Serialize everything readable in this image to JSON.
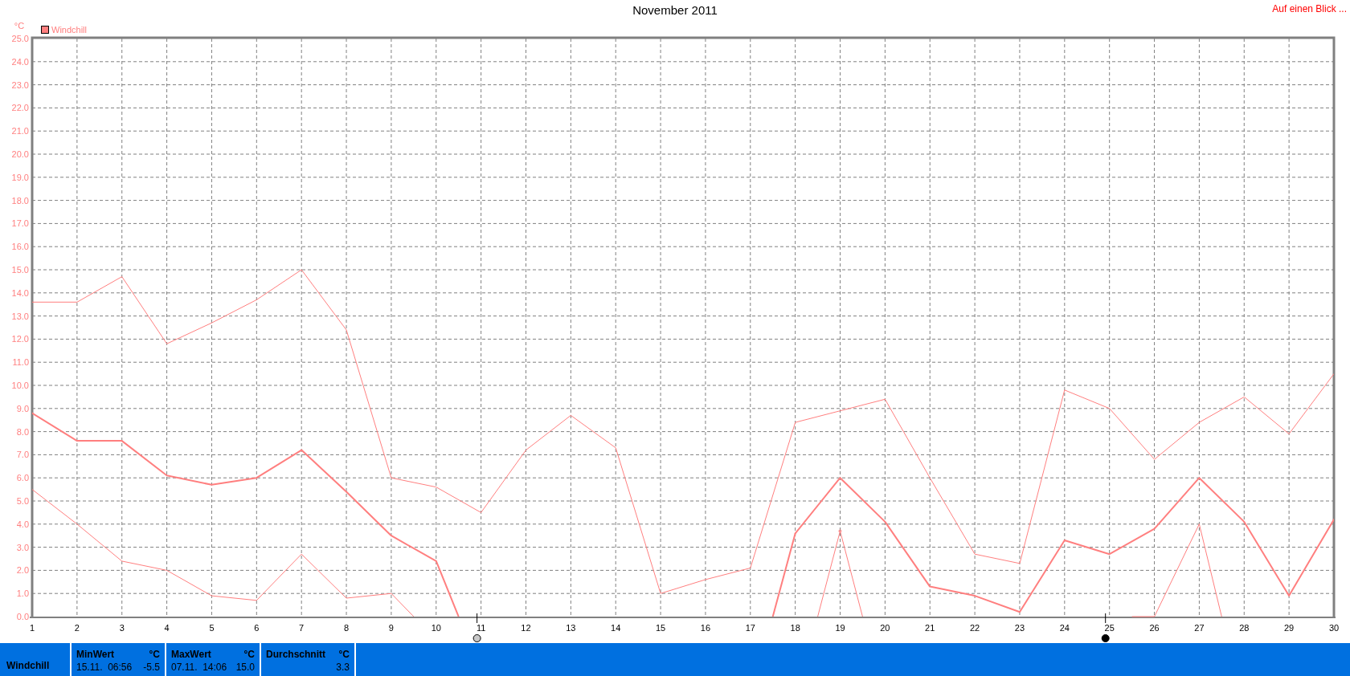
{
  "link": {
    "label": "Auf einen Blick ..."
  },
  "chart": {
    "chart_data": {
      "type": "line",
      "title": "November 2011",
      "ylabel": "°C",
      "x": [
        1,
        2,
        3,
        4,
        5,
        6,
        7,
        8,
        9,
        10,
        11,
        12,
        13,
        14,
        15,
        16,
        17,
        18,
        19,
        20,
        21,
        22,
        23,
        24,
        25,
        26,
        27,
        28,
        29,
        30
      ],
      "xlim": [
        1,
        30
      ],
      "ylim": [
        0,
        25
      ],
      "xticks": [
        1,
        2,
        3,
        4,
        5,
        6,
        7,
        8,
        9,
        10,
        11,
        12,
        13,
        14,
        15,
        16,
        17,
        18,
        19,
        20,
        21,
        22,
        23,
        24,
        25,
        26,
        27,
        28,
        29,
        30
      ],
      "yticks": [
        {
          "value": 0,
          "label": "0.0"
        },
        {
          "value": 1,
          "label": "1.0"
        },
        {
          "value": 2,
          "label": "2.0"
        },
        {
          "value": 3,
          "label": "3.0"
        },
        {
          "value": 4,
          "label": "4.0"
        },
        {
          "value": 5,
          "label": "5.0"
        },
        {
          "value": 6,
          "label": "6.0"
        },
        {
          "value": 7,
          "label": "7.0"
        },
        {
          "value": 8,
          "label": "8.0"
        },
        {
          "value": 9,
          "label": "9.0"
        },
        {
          "value": 10,
          "label": "10.0"
        },
        {
          "value": 11,
          "label": "11.0"
        },
        {
          "value": 12,
          "label": "12.0"
        },
        {
          "value": 13,
          "label": "13.0"
        },
        {
          "value": 14,
          "label": "14.0"
        },
        {
          "value": 15,
          "label": "15.0"
        },
        {
          "value": 16,
          "label": "16.0"
        },
        {
          "value": 17,
          "label": "17.0"
        },
        {
          "value": 18,
          "label": "18.0"
        },
        {
          "value": 19,
          "label": "19.0"
        },
        {
          "value": 20,
          "label": "20.0"
        },
        {
          "value": 21,
          "label": "21.0"
        },
        {
          "value": 22,
          "label": "22.0"
        },
        {
          "value": 23,
          "label": "23.0"
        },
        {
          "value": 24,
          "label": "24.0"
        },
        {
          "value": 25,
          "label": "25.0"
        }
      ],
      "series": [
        {
          "color": "#ff7f7f",
          "values": [
            13.6,
            13.6,
            14.7,
            11.8,
            12.7,
            13.7,
            15.0,
            12.4,
            6.0,
            5.6,
            4.5,
            7.2,
            8.7,
            7.3,
            1.0,
            1.6,
            2.1,
            8.4,
            8.9,
            9.4,
            6.0,
            2.7,
            2.3,
            9.8,
            9.0,
            6.8,
            8.4,
            9.5,
            7.9,
            10.5
          ]
        },
        {
          "name": "Windchill",
          "color": "#ff7f7f",
          "values": [
            8.8,
            7.6,
            7.6,
            6.1,
            5.7,
            6.0,
            7.2,
            5.4,
            3.5,
            2.4,
            null,
            null,
            null,
            null,
            null,
            null,
            null,
            3.6,
            6.0,
            4.1,
            1.3,
            0.9,
            0.2,
            3.3,
            2.7,
            3.8,
            6.0,
            4.1,
            0.9,
            4.2
          ]
        },
        {
          "color": "#ff7f7f",
          "values": [
            5.5,
            4.0,
            2.4,
            2.0,
            0.9,
            0.7,
            2.7,
            0.8,
            1.0,
            null,
            null,
            null,
            null,
            null,
            null,
            null,
            null,
            null,
            3.7,
            null,
            null,
            null,
            null,
            null,
            null,
            0.0,
            4.0,
            null,
            null,
            null
          ]
        }
      ],
      "grid": true
    },
    "moon_markers": [
      {
        "day": "11",
        "kind": "full_moon"
      },
      {
        "day": "25",
        "kind": "new_moon"
      }
    ]
  },
  "status_bar": {
    "label": "Windchill",
    "stats": [
      {
        "title": "MinWert",
        "unit": "°C",
        "date": "15.11.",
        "time": "06:56",
        "value": "-5.5"
      },
      {
        "title": "MaxWert",
        "unit": "°C",
        "date": "07.11.",
        "time": "14:06",
        "value": "15.0"
      },
      {
        "title": "Durchschnitt",
        "unit": "°C",
        "value": "3.3"
      }
    ]
  }
}
